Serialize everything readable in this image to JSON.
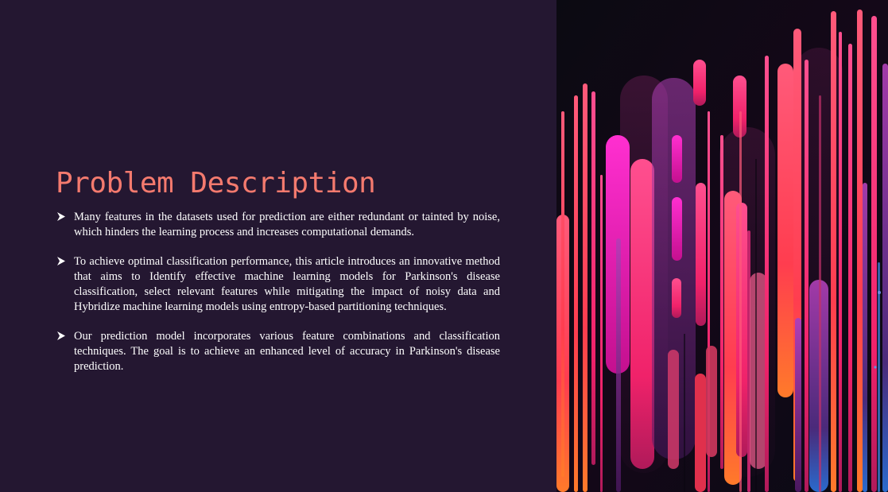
{
  "slide": {
    "title": "Problem Description",
    "bullets": [
      "Many features in the datasets used for prediction are either redundant or tainted by noise, which hinders the learning process and increases computational demands.",
      "To achieve optimal classification performance, this article introduces an innovative method that aims to Identify effective machine learning models for Parkinson's disease classification, select relevant features while mitigating the impact of noisy data and Hybridize machine learning models using entropy-based partitioning techniques.",
      "Our prediction model incorporates various feature combinations and classification techniques. The goal is to achieve an enhanced level of accuracy in Parkinson's disease prediction."
    ],
    "bullet_icon": "arrowhead-icon"
  },
  "image": {
    "icon": "abstract-neon-bars-image"
  },
  "colors": {
    "background": "#241731",
    "title": "#F47A6E",
    "text": "#FFFFFF"
  }
}
